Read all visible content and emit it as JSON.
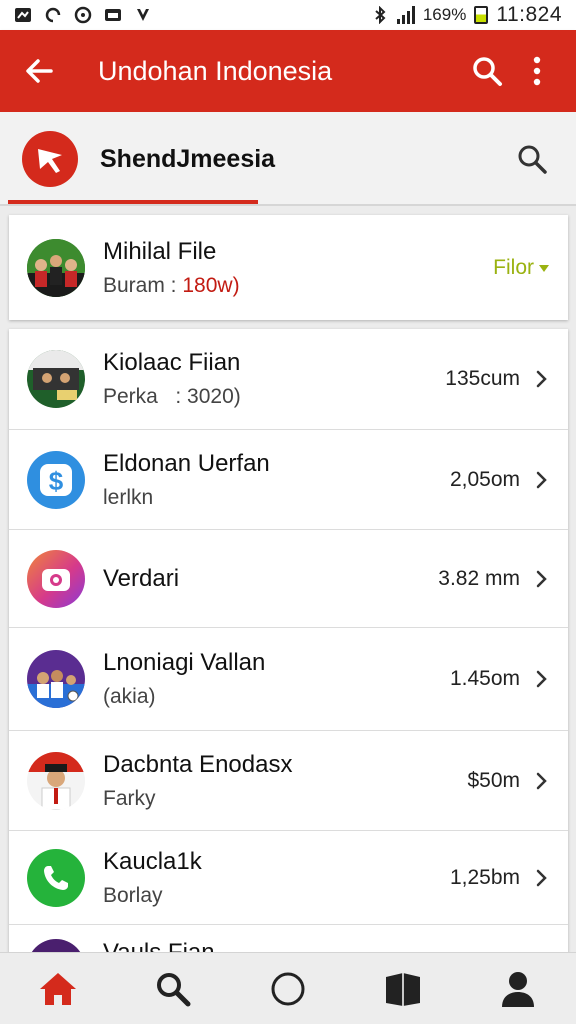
{
  "status_bar": {
    "battery_percent": "169%",
    "time": "11:824"
  },
  "app_bar": {
    "title": "Undohan Indonesia",
    "back_icon": "arrow-left-icon",
    "search_icon": "search-icon",
    "more_icon": "more-vert-icon"
  },
  "sub_header": {
    "title": "ShendJmeesia",
    "logo_icon": "cursor-logo-icon",
    "search_icon": "search-icon"
  },
  "top_card": {
    "name": "Mihilal File",
    "sub_prefix": "Buram : ",
    "sub_highlight": "180w)",
    "filter_label": "Filor",
    "colors": {
      "filter": "#9ab211",
      "highlight": "#c21b12"
    }
  },
  "list": [
    {
      "name": "Kiolaac Fiian",
      "sub": "Perka   : 3020)",
      "value": "135cum",
      "avatar": "group-photo"
    },
    {
      "name": "Eldonan Uerfan",
      "sub": "lerlkn",
      "value": "2,05om",
      "avatar": "dollar-icon"
    },
    {
      "name": "Verdari",
      "sub": "",
      "value": "3.82 mm",
      "avatar": "camera-icon"
    },
    {
      "name": "Lnoniagi Vallan",
      "sub": "(akia)",
      "value": "1.45om",
      "avatar": "group-photo"
    },
    {
      "name": "Dacbnta Enodasx",
      "sub": "Farky",
      "value": "$50m",
      "avatar": "person-photo"
    },
    {
      "name": "Kaucla1k",
      "sub": "Borlay",
      "value": "1,25bm",
      "avatar": "phone-icon"
    },
    {
      "name": "Vauls Fian",
      "sub": "",
      "value": "",
      "avatar": "purple"
    }
  ],
  "bottom_nav": [
    {
      "icon": "home-icon",
      "color": "#d42a1c"
    },
    {
      "icon": "search-icon",
      "color": "#222222"
    },
    {
      "icon": "circle-icon",
      "color": "#222222"
    },
    {
      "icon": "book-icon",
      "color": "#222222"
    },
    {
      "icon": "person-icon",
      "color": "#222222"
    }
  ],
  "theme": {
    "primary": "#d42a1c"
  }
}
